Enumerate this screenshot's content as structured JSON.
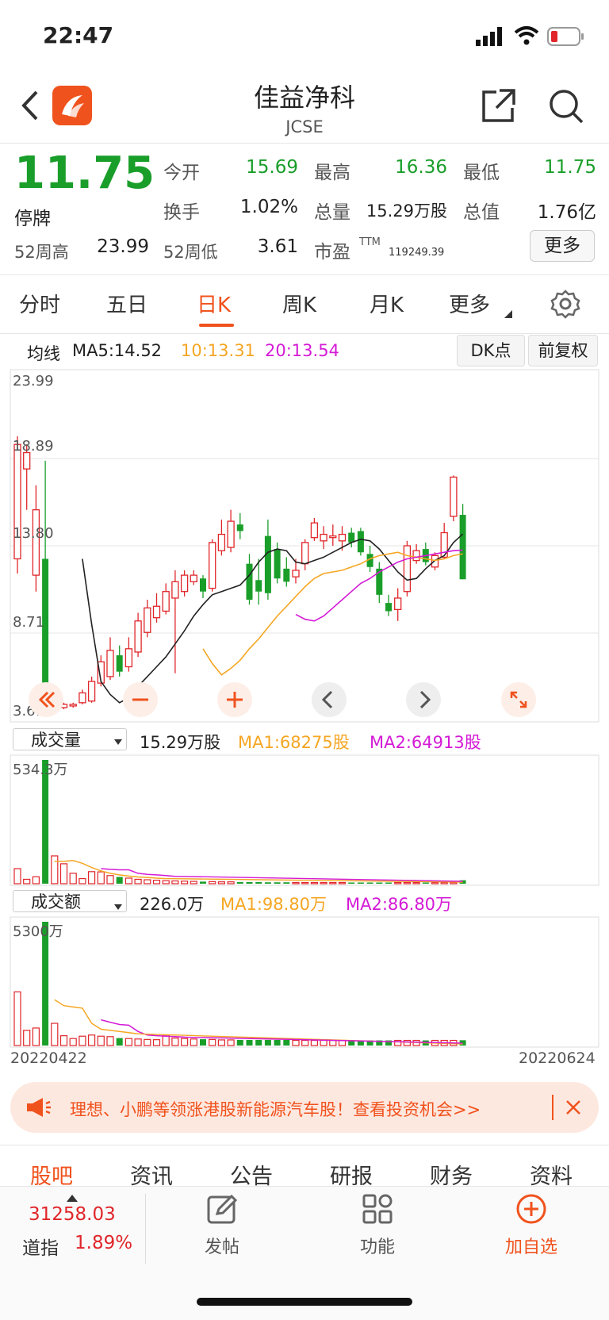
{
  "status": {
    "time": "22:47"
  },
  "header": {
    "title": "佳益净科",
    "code": "JCSE"
  },
  "quote": {
    "price": "11.75",
    "status": "停牌",
    "open_label": "今开",
    "open": "15.69",
    "high_label": "最高",
    "high": "16.36",
    "low_label": "最低",
    "low": "11.75",
    "turnover_label": "换手",
    "turnover": "1.02%",
    "volume_label": "总量",
    "volume": "15.29万股",
    "mktcap_label": "总值",
    "mktcap": "1.76亿",
    "w52high_label": "52周高",
    "w52high": "23.99",
    "w52low_label": "52周低",
    "w52low": "3.61",
    "pe_label": "市盈",
    "pe_sup": "TTM",
    "pe": "119249.39",
    "more_label": "更多"
  },
  "tabs": [
    "分时",
    "五日",
    "日K",
    "周K",
    "月K",
    "更多"
  ],
  "ma": {
    "label": "均线",
    "ma5": "MA5:14.52",
    "ma10": "10:13.31",
    "ma20": "20:13.54",
    "dk_label": "DK点",
    "adjust_label": "前复权"
  },
  "colors": {
    "up": "#e0262a",
    "down": "#1a9e2a",
    "accent": "#f0521d",
    "ma5": "#222222",
    "ma10": "#f5a623",
    "ma20": "#d41ad6"
  },
  "chart_data": [
    {
      "type": "candlestick",
      "axis_labels": [
        "23.99",
        "18.89",
        "13.80",
        "8.71",
        "3.61"
      ],
      "ylim": [
        3.61,
        23.99
      ],
      "candles": [
        [
          13,
          20,
          12.1,
          20.5,
          "u"
        ],
        [
          18.5,
          19.5,
          16,
          20,
          "u"
        ],
        [
          12,
          16,
          11,
          17.5,
          "u"
        ],
        [
          3.8,
          13,
          3.5,
          19,
          "d"
        ],
        [
          3.9,
          4.0,
          3.8,
          4.1,
          "u"
        ],
        [
          3.9,
          4.1,
          3.8,
          4.2,
          "u"
        ],
        [
          4.0,
          4.1,
          3.9,
          4.2,
          "u"
        ],
        [
          4.2,
          4.8,
          4.1,
          5.0,
          "u"
        ],
        [
          4.3,
          5.5,
          4.2,
          5.8,
          "u"
        ],
        [
          5.4,
          6.7,
          5.2,
          7.1,
          "u"
        ],
        [
          5.8,
          7.4,
          5.6,
          8.2,
          "u"
        ],
        [
          7.1,
          6.1,
          5.8,
          7.7,
          "d"
        ],
        [
          6.4,
          7.5,
          6.1,
          8.2,
          "u"
        ],
        [
          7.3,
          9.2,
          7.0,
          9.7,
          "u"
        ],
        [
          8.5,
          10.0,
          8.2,
          10.5,
          "u"
        ],
        [
          9.4,
          10.1,
          9.1,
          10.9,
          "u"
        ],
        [
          9.8,
          11.0,
          9.6,
          11.5,
          "u"
        ],
        [
          10.6,
          11.6,
          6.0,
          12.3,
          "u"
        ],
        [
          11.0,
          12.0,
          10.7,
          12.3,
          "u"
        ],
        [
          11.6,
          12.0,
          11.4,
          12.3,
          "u"
        ],
        [
          11.8,
          11.0,
          10.6,
          12.0,
          "d"
        ],
        [
          11.2,
          14.0,
          11.0,
          14.2,
          "u"
        ],
        [
          13.5,
          14.5,
          13.2,
          15.4,
          "u"
        ],
        [
          13.7,
          15.3,
          13.4,
          16.0,
          "u"
        ],
        [
          15.1,
          14.7,
          14.2,
          15.8,
          "d"
        ],
        [
          12.7,
          10.5,
          10.2,
          13.3,
          "d"
        ],
        [
          11.7,
          11.0,
          10.2,
          13.0,
          "d"
        ],
        [
          14.4,
          10.9,
          10.5,
          15.4,
          "d"
        ],
        [
          13.6,
          11.8,
          11.5,
          14.0,
          "d"
        ],
        [
          12.4,
          11.6,
          11.3,
          13.1,
          "d"
        ],
        [
          11.9,
          12.3,
          11.5,
          13.0,
          "u"
        ],
        [
          12.7,
          14.0,
          12.3,
          14.2,
          "u"
        ],
        [
          14.3,
          15.2,
          14.1,
          15.5,
          "u"
        ],
        [
          14.1,
          14.5,
          13.6,
          15.0,
          "u"
        ],
        [
          14.3,
          14.4,
          13.8,
          15.1,
          "u"
        ],
        [
          14.1,
          14.5,
          13.5,
          15.0,
          "u"
        ],
        [
          14.6,
          14.0,
          13.7,
          14.9,
          "d"
        ],
        [
          14.7,
          13.4,
          13.2,
          14.9,
          "d"
        ],
        [
          13.3,
          12.5,
          12.2,
          13.8,
          "d"
        ],
        [
          12.4,
          10.8,
          10.3,
          12.8,
          "d"
        ],
        [
          10.3,
          9.8,
          9.5,
          10.8,
          "d"
        ],
        [
          9.9,
          10.6,
          9.2,
          11.2,
          "u"
        ],
        [
          11.0,
          13.8,
          10.7,
          14.1,
          "u"
        ],
        [
          12.9,
          13.5,
          12.7,
          13.9,
          "u"
        ],
        [
          13.6,
          12.8,
          12.6,
          14.0,
          "d"
        ],
        [
          12.5,
          13.2,
          12.3,
          13.4,
          "u"
        ],
        [
          13.1,
          14.6,
          13.0,
          15.2,
          "u"
        ],
        [
          15.6,
          18.0,
          15.3,
          18.1,
          "u"
        ],
        [
          15.69,
          11.75,
          11.75,
          16.36,
          "d"
        ]
      ],
      "ma5": [
        13.0,
        9.0,
        5.5,
        4.7,
        4.2,
        4.5,
        5.2,
        5.8,
        6.4,
        7.0,
        7.8,
        8.6,
        9.5,
        10.2,
        10.8,
        11.0,
        11.2,
        11.4,
        12.0,
        12.8,
        13.4,
        13.6,
        13.5,
        12.8,
        12.7,
        12.9,
        13.1,
        13.4,
        13.7,
        14.0,
        14.2,
        14.1,
        13.6,
        12.9,
        12.2,
        11.7,
        11.8,
        12.4,
        12.9,
        13.2,
        14.0,
        14.52
      ],
      "ma10": [
        7.5,
        6.6,
        5.9,
        6.3,
        6.8,
        7.5,
        8.1,
        8.8,
        9.5,
        10.1,
        10.7,
        11.3,
        11.8,
        12.1,
        12.2,
        12.3,
        12.5,
        12.7,
        13.0,
        13.2,
        13.3,
        13.4,
        13.2,
        13.1,
        13.0,
        12.9,
        13.0,
        13.2,
        13.31
      ],
      "ma20": [
        9.6,
        9.3,
        9.2,
        9.5,
        10.0,
        10.5,
        11.0,
        11.5,
        11.8,
        12.2,
        12.5,
        12.8,
        13.0,
        13.1,
        13.2,
        13.3,
        13.4,
        13.5,
        13.54
      ]
    },
    {
      "type": "bar",
      "title": "成交量",
      "value_label": "15.29万股",
      "ma1_label": "MA1:68275股",
      "ma2_label": "MA2:64913股",
      "axis_max_label": "534.3万",
      "values": [
        65,
        19,
        30,
        534,
        120,
        86,
        45,
        22,
        52,
        51,
        35,
        29,
        24,
        19,
        17,
        15,
        13,
        12,
        11,
        10,
        9,
        9,
        8,
        8,
        7,
        7,
        7,
        6,
        6,
        6,
        5,
        5,
        5,
        5,
        5,
        5,
        5,
        5,
        5,
        5,
        5,
        5,
        5,
        5,
        5,
        5,
        5,
        5,
        15
      ],
      "ma1": [
        97,
        97,
        100,
        88,
        70,
        55,
        45,
        38,
        33,
        29,
        27,
        24,
        22
      ],
      "ma2": [
        65,
        62,
        60,
        60,
        45,
        40,
        38,
        35,
        32
      ]
    },
    {
      "type": "bar",
      "title": "成交额",
      "value_label": "226.0万",
      "ma1_label": "MA1:98.80万",
      "ma2_label": "MA2:86.80万",
      "axis_max_label": "5300万",
      "values": [
        2300,
        650,
        750,
        5300,
        950,
        420,
        300,
        400,
        450,
        400,
        380,
        320,
        300,
        280,
        260,
        250,
        450,
        320,
        300,
        280,
        270,
        260,
        240,
        240,
        240,
        240,
        240,
        240,
        240,
        240,
        220,
        220,
        220,
        220,
        220,
        220,
        220,
        220,
        220,
        220,
        220,
        220,
        220,
        220,
        220,
        220,
        220,
        220,
        226
      ],
      "ma1": [
        1960,
        1710,
        1650,
        1600,
        950,
        700,
        650,
        600,
        550,
        500
      ],
      "ma2": [
        1100,
        1000,
        900,
        870,
        600,
        450,
        420,
        400,
        380,
        360
      ],
      "date_start": "20220422",
      "date_end": "20220624"
    }
  ],
  "banner": {
    "text": "理想、小鹏等领涨港股新能源汽车股！查看投资机会>>"
  },
  "bottom_tabs": [
    "股吧",
    "资讯",
    "公告",
    "研报",
    "财务",
    "资料"
  ],
  "tabbar": {
    "index_value": "31258.03",
    "index_name": "道指",
    "index_change": "1.89%",
    "post_label": "发帖",
    "func_label": "功能",
    "add_label": "加自选"
  }
}
